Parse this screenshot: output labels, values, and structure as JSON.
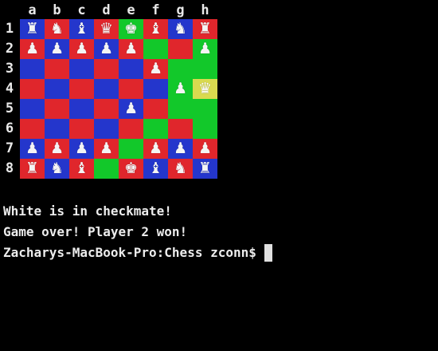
{
  "files": [
    "a",
    "b",
    "c",
    "d",
    "e",
    "f",
    "g",
    "h"
  ],
  "ranks": [
    "1",
    "2",
    "3",
    "4",
    "5",
    "6",
    "7",
    "8"
  ],
  "colors": {
    "red": "#e0262c",
    "blue": "#2436cc",
    "green": "#12c82a",
    "yellow": "#d9da4f",
    "background": "#000000",
    "text": "#ececec"
  },
  "board": [
    [
      {
        "c": "blue",
        "p": "♜"
      },
      {
        "c": "red",
        "p": "♞"
      },
      {
        "c": "blue",
        "p": "♝"
      },
      {
        "c": "red",
        "p": "♛"
      },
      {
        "c": "green",
        "p": "♚"
      },
      {
        "c": "red",
        "p": "♝"
      },
      {
        "c": "blue",
        "p": "♞"
      },
      {
        "c": "red",
        "p": "♜"
      }
    ],
    [
      {
        "c": "red",
        "p": "♟"
      },
      {
        "c": "blue",
        "p": "♟"
      },
      {
        "c": "red",
        "p": "♟"
      },
      {
        "c": "blue",
        "p": "♟"
      },
      {
        "c": "red",
        "p": "♟"
      },
      {
        "c": "green",
        "p": ""
      },
      {
        "c": "red",
        "p": ""
      },
      {
        "c": "green",
        "p": "♟"
      }
    ],
    [
      {
        "c": "blue",
        "p": ""
      },
      {
        "c": "red",
        "p": ""
      },
      {
        "c": "blue",
        "p": ""
      },
      {
        "c": "red",
        "p": ""
      },
      {
        "c": "blue",
        "p": ""
      },
      {
        "c": "red",
        "p": "♟"
      },
      {
        "c": "green",
        "p": ""
      },
      {
        "c": "green",
        "p": ""
      }
    ],
    [
      {
        "c": "red",
        "p": ""
      },
      {
        "c": "blue",
        "p": ""
      },
      {
        "c": "red",
        "p": ""
      },
      {
        "c": "blue",
        "p": ""
      },
      {
        "c": "red",
        "p": ""
      },
      {
        "c": "blue",
        "p": ""
      },
      {
        "c": "green",
        "p": "♟"
      },
      {
        "c": "yellow",
        "p": "♛"
      }
    ],
    [
      {
        "c": "blue",
        "p": ""
      },
      {
        "c": "red",
        "p": ""
      },
      {
        "c": "blue",
        "p": ""
      },
      {
        "c": "red",
        "p": ""
      },
      {
        "c": "blue",
        "p": "♟"
      },
      {
        "c": "red",
        "p": ""
      },
      {
        "c": "green",
        "p": ""
      },
      {
        "c": "green",
        "p": ""
      }
    ],
    [
      {
        "c": "red",
        "p": ""
      },
      {
        "c": "blue",
        "p": ""
      },
      {
        "c": "red",
        "p": ""
      },
      {
        "c": "blue",
        "p": ""
      },
      {
        "c": "red",
        "p": ""
      },
      {
        "c": "green",
        "p": ""
      },
      {
        "c": "red",
        "p": ""
      },
      {
        "c": "green",
        "p": ""
      }
    ],
    [
      {
        "c": "blue",
        "p": "♟"
      },
      {
        "c": "red",
        "p": "♟"
      },
      {
        "c": "blue",
        "p": "♟"
      },
      {
        "c": "red",
        "p": "♟"
      },
      {
        "c": "green",
        "p": ""
      },
      {
        "c": "red",
        "p": "♟"
      },
      {
        "c": "blue",
        "p": "♟"
      },
      {
        "c": "red",
        "p": "♟"
      }
    ],
    [
      {
        "c": "red",
        "p": "♜"
      },
      {
        "c": "blue",
        "p": "♞"
      },
      {
        "c": "red",
        "p": "♝"
      },
      {
        "c": "green",
        "p": ""
      },
      {
        "c": "red",
        "p": "♚"
      },
      {
        "c": "blue",
        "p": "♝"
      },
      {
        "c": "red",
        "p": "♞"
      },
      {
        "c": "blue",
        "p": "♜"
      }
    ]
  ],
  "messages": {
    "checkmate": "White is in checkmate!",
    "game_over": "Game over! Player 2 won!",
    "prompt": "Zacharys-MacBook-Pro:Chess zconn$"
  }
}
